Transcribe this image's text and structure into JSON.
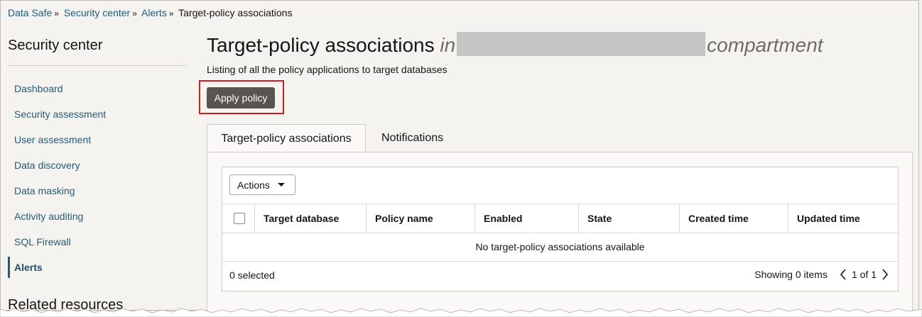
{
  "breadcrumb": {
    "items": [
      "Data Safe",
      "Security center",
      "Alerts"
    ],
    "current": "Target-policy associations",
    "separator": "»"
  },
  "sidebar": {
    "title": "Security center",
    "items": [
      {
        "label": "Dashboard"
      },
      {
        "label": "Security assessment"
      },
      {
        "label": "User assessment"
      },
      {
        "label": "Data discovery"
      },
      {
        "label": "Data masking"
      },
      {
        "label": "Activity auditing"
      },
      {
        "label": "SQL Firewall"
      },
      {
        "label": "Alerts",
        "active": true
      }
    ],
    "related_title": "Related resources"
  },
  "header": {
    "title": "Target-policy associations",
    "title_in": "in",
    "title_suffix": "compartment",
    "subtitle": "Listing of all the policy applications to target databases"
  },
  "apply_button": "Apply policy",
  "tabs": [
    {
      "label": "Target-policy associations",
      "active": true
    },
    {
      "label": "Notifications",
      "active": false
    }
  ],
  "table": {
    "actions_label": "Actions",
    "columns": [
      "Target database",
      "Policy name",
      "Enabled",
      "State",
      "Created time",
      "Updated time"
    ],
    "empty_message": "No target-policy associations available",
    "selected_text": "0 selected",
    "showing_text": "Showing 0 items",
    "page_text": "1 of 1"
  },
  "colors": {
    "link": "#1f5c77",
    "primary_button": "#5a5450",
    "highlight_border": "#d01c23"
  }
}
